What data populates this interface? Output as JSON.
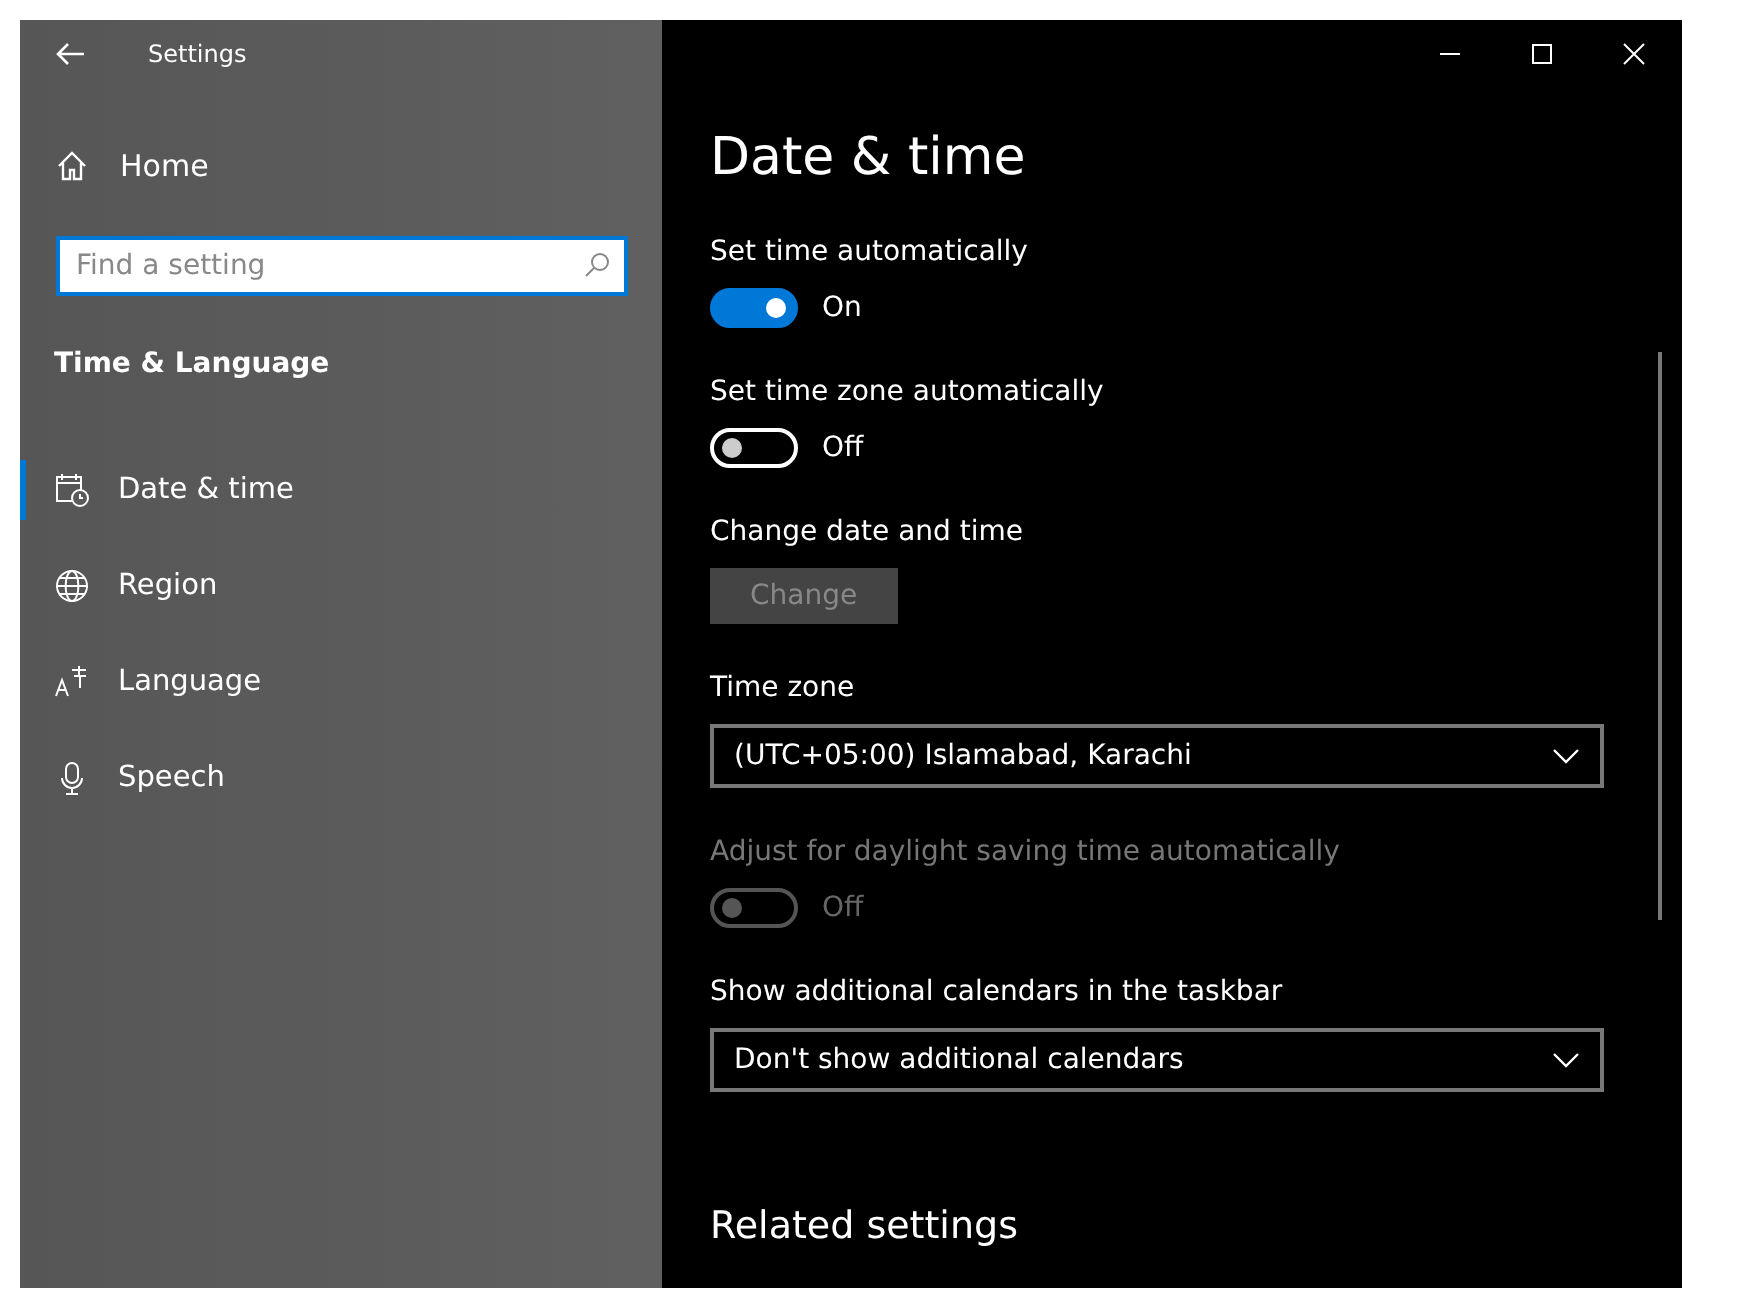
{
  "window": {
    "title": "Settings"
  },
  "sidebar": {
    "home": "Home",
    "search": {
      "placeholder": "Find a setting"
    },
    "section": "Time & Language",
    "items": [
      {
        "label": "Date & time",
        "selected": true
      },
      {
        "label": "Region",
        "selected": false
      },
      {
        "label": "Language",
        "selected": false
      },
      {
        "label": "Speech",
        "selected": false
      }
    ]
  },
  "page": {
    "title": "Date & time",
    "settings": [
      {
        "kind": "toggle",
        "label": "Set time automatically",
        "on": true,
        "state_text": "On",
        "disabled": false
      },
      {
        "kind": "toggle",
        "label": "Set time zone automatically",
        "on": false,
        "state_text": "Off",
        "disabled": false
      },
      {
        "kind": "button",
        "label": "Change date and time",
        "button": "Change",
        "disabled": true
      },
      {
        "kind": "dropdown",
        "label": "Time zone",
        "value": "(UTC+05:00) Islamabad, Karachi"
      },
      {
        "kind": "toggle",
        "label": "Adjust for daylight saving time automatically",
        "on": false,
        "state_text": "Off",
        "disabled": true
      },
      {
        "kind": "dropdown",
        "label": "Show additional calendars in the taskbar",
        "value": "Don't show additional calendars"
      }
    ],
    "related_title": "Related settings"
  }
}
